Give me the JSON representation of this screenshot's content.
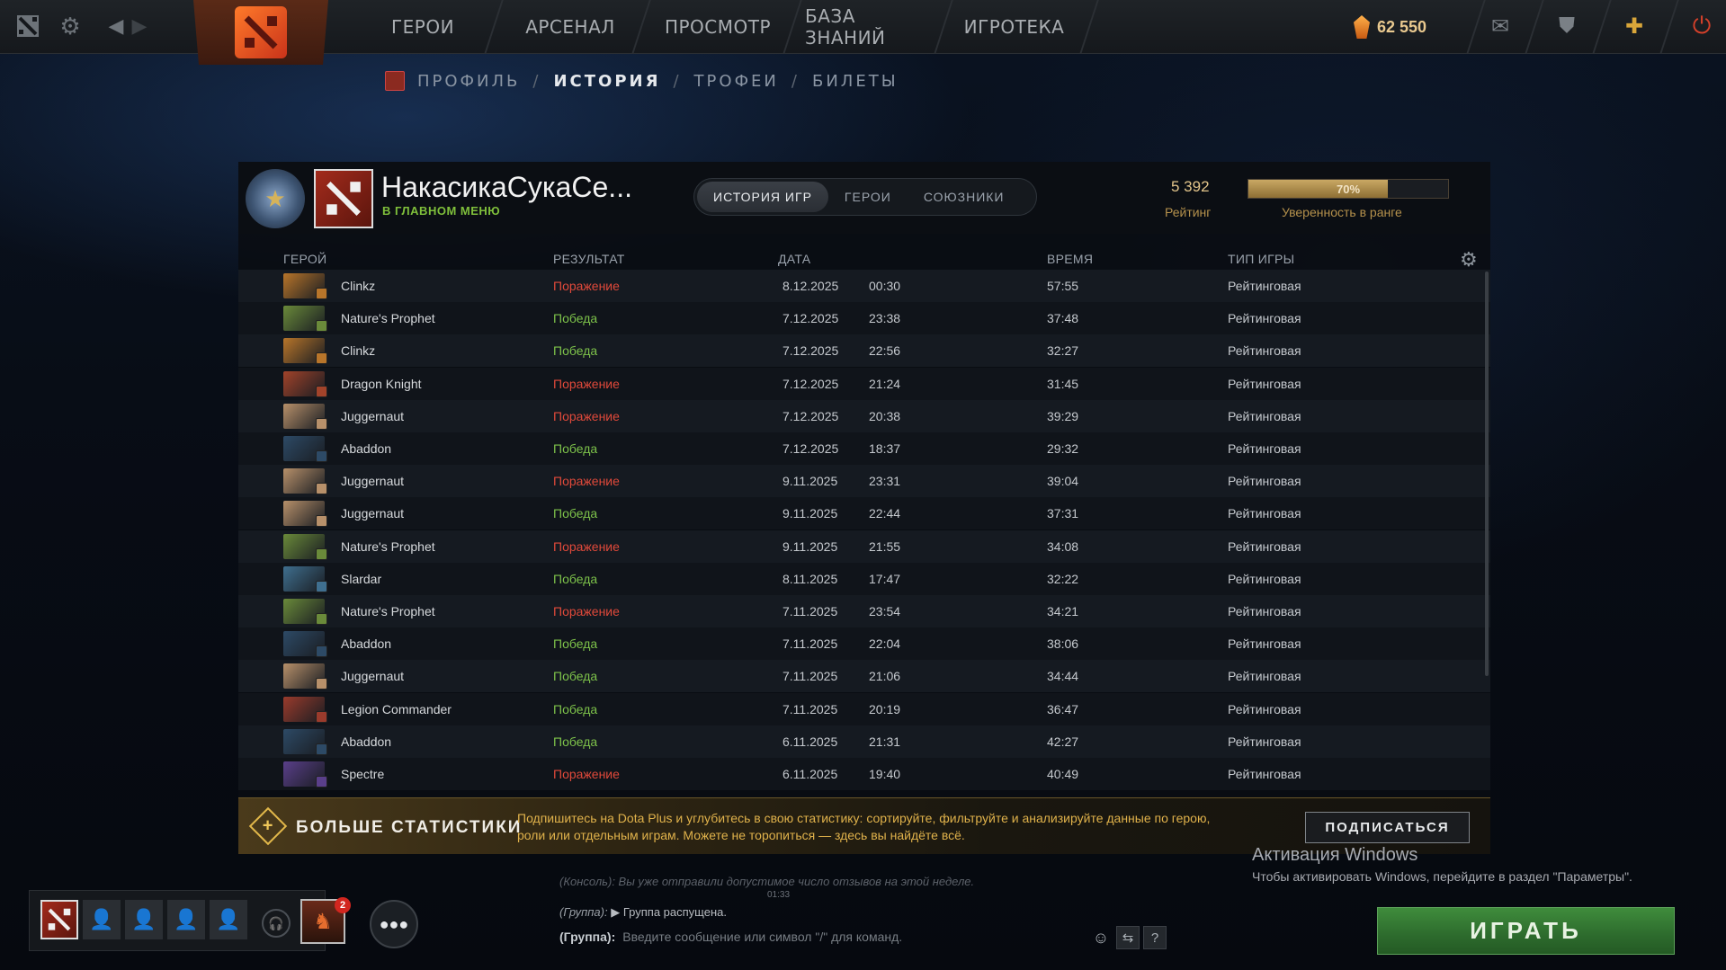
{
  "topbar": {
    "nav": [
      "ГЕРОИ",
      "АРСЕНАЛ",
      "ПРОСМОТР",
      "БАЗА ЗНАНИЙ",
      "ИГРОТЕКА"
    ],
    "currency_value": "62 550",
    "icons": [
      "dota-logo-icon",
      "settings-gear-icon",
      "back-arrow-icon",
      "forward-arrow-icon",
      "mail-icon",
      "armory-icon",
      "dota-plus-icon",
      "power-icon"
    ]
  },
  "subnav": {
    "items": [
      "ПРОФИЛЬ",
      "ИСТОРИЯ",
      "ТРОФЕИ",
      "БИЛЕТЫ"
    ],
    "separator": "/"
  },
  "profile": {
    "name": "НакасикаСукаСе...",
    "status": "В ГЛАВНОМ МЕНЮ",
    "tabs": [
      "ИСТОРИЯ ИГР",
      "ГЕРОИ",
      "СОЮЗНИКИ"
    ],
    "rating_value": "5 392",
    "rating_label": "Рейтинг",
    "confidence_percent": 70,
    "confidence_text": "70%",
    "confidence_label": "Уверенность в ранге"
  },
  "table": {
    "headers": {
      "hero": "ГЕРОЙ",
      "result": "РЕЗУЛЬТАТ",
      "date": "ДАТА",
      "duration": "ВРЕМЯ",
      "type": "ТИП ИГРЫ"
    },
    "rows": [
      {
        "hero": "Clinkz",
        "result": "Поражение",
        "win": false,
        "date": "8.12.2025",
        "time": "00:30",
        "duration": "57:55",
        "type": "Рейтинговая",
        "color": "#b8752a"
      },
      {
        "hero": "Nature's Prophet",
        "result": "Победа",
        "win": true,
        "date": "7.12.2025",
        "time": "23:38",
        "duration": "37:48",
        "type": "Рейтинговая",
        "color": "#6a8a3a"
      },
      {
        "hero": "Clinkz",
        "result": "Победа",
        "win": true,
        "date": "7.12.2025",
        "time": "22:56",
        "duration": "32:27",
        "type": "Рейтинговая",
        "color": "#b8752a"
      },
      {
        "hero": "Dragon Knight",
        "result": "Поражение",
        "win": false,
        "date": "7.12.2025",
        "time": "21:24",
        "duration": "31:45",
        "type": "Рейтинговая",
        "color": "#a2432a"
      },
      {
        "hero": "Juggernaut",
        "result": "Поражение",
        "win": false,
        "date": "7.12.2025",
        "time": "20:38",
        "duration": "39:29",
        "type": "Рейтинговая",
        "color": "#b7906a"
      },
      {
        "hero": "Abaddon",
        "result": "Победа",
        "win": true,
        "date": "7.12.2025",
        "time": "18:37",
        "duration": "29:32",
        "type": "Рейтинговая",
        "color": "#2d4a66"
      },
      {
        "hero": "Juggernaut",
        "result": "Поражение",
        "win": false,
        "date": "9.11.2025",
        "time": "23:31",
        "duration": "39:04",
        "type": "Рейтинговая",
        "color": "#b7906a"
      },
      {
        "hero": "Juggernaut",
        "result": "Победа",
        "win": true,
        "date": "9.11.2025",
        "time": "22:44",
        "duration": "37:31",
        "type": "Рейтинговая",
        "color": "#b7906a"
      },
      {
        "hero": "Nature's Prophet",
        "result": "Поражение",
        "win": false,
        "date": "9.11.2025",
        "time": "21:55",
        "duration": "34:08",
        "type": "Рейтинговая",
        "color": "#6a8a3a"
      },
      {
        "hero": "Slardar",
        "result": "Победа",
        "win": true,
        "date": "8.11.2025",
        "time": "17:47",
        "duration": "32:22",
        "type": "Рейтинговая",
        "color": "#3f6f8f"
      },
      {
        "hero": "Nature's Prophet",
        "result": "Поражение",
        "win": false,
        "date": "7.11.2025",
        "time": "23:54",
        "duration": "34:21",
        "type": "Рейтинговая",
        "color": "#6a8a3a"
      },
      {
        "hero": "Abaddon",
        "result": "Победа",
        "win": true,
        "date": "7.11.2025",
        "time": "22:04",
        "duration": "38:06",
        "type": "Рейтинговая",
        "color": "#2d4a66"
      },
      {
        "hero": "Juggernaut",
        "result": "Победа",
        "win": true,
        "date": "7.11.2025",
        "time": "21:06",
        "duration": "34:44",
        "type": "Рейтинговая",
        "color": "#b7906a"
      },
      {
        "hero": "Legion Commander",
        "result": "Победа",
        "win": true,
        "date": "7.11.2025",
        "time": "20:19",
        "duration": "36:47",
        "type": "Рейтинговая",
        "color": "#9a3b2c"
      },
      {
        "hero": "Abaddon",
        "result": "Победа",
        "win": true,
        "date": "6.11.2025",
        "time": "21:31",
        "duration": "42:27",
        "type": "Рейтинговая",
        "color": "#2d4a66"
      },
      {
        "hero": "Spectre",
        "result": "Поражение",
        "win": false,
        "date": "6.11.2025",
        "time": "19:40",
        "duration": "40:49",
        "type": "Рейтинговая",
        "color": "#5a3f8a"
      }
    ]
  },
  "plus_banner": {
    "title": "БОЛЬШЕ СТАТИСТИКИ",
    "text": "Подпишитесь на Dota Plus и углубитесь в свою статистику: сортируйте, фильтруйте и анализируйте данные по герою, роли или отдельным играм. Можете не торопиться — здесь вы найдёте всё.",
    "button": "ПОДПИСАТЬСЯ"
  },
  "windows_watermark": {
    "title": "Активация Windows",
    "subtitle": "Чтобы активировать Windows, перейдите в раздел \"Параметры\"."
  },
  "chat": {
    "old_line": "(Консоль): Вы уже отправили допустимое число отзывов на этой неделе.",
    "timestamp": "01:33",
    "line_channel": "(Группа):",
    "line_text": "Группа распущена.",
    "input_channel": "(Группа):",
    "input_placeholder": "Введите сообщение или символ \"/\" для команд."
  },
  "party": {
    "notification_count": "2"
  },
  "play_button": "ИГРАТЬ"
}
